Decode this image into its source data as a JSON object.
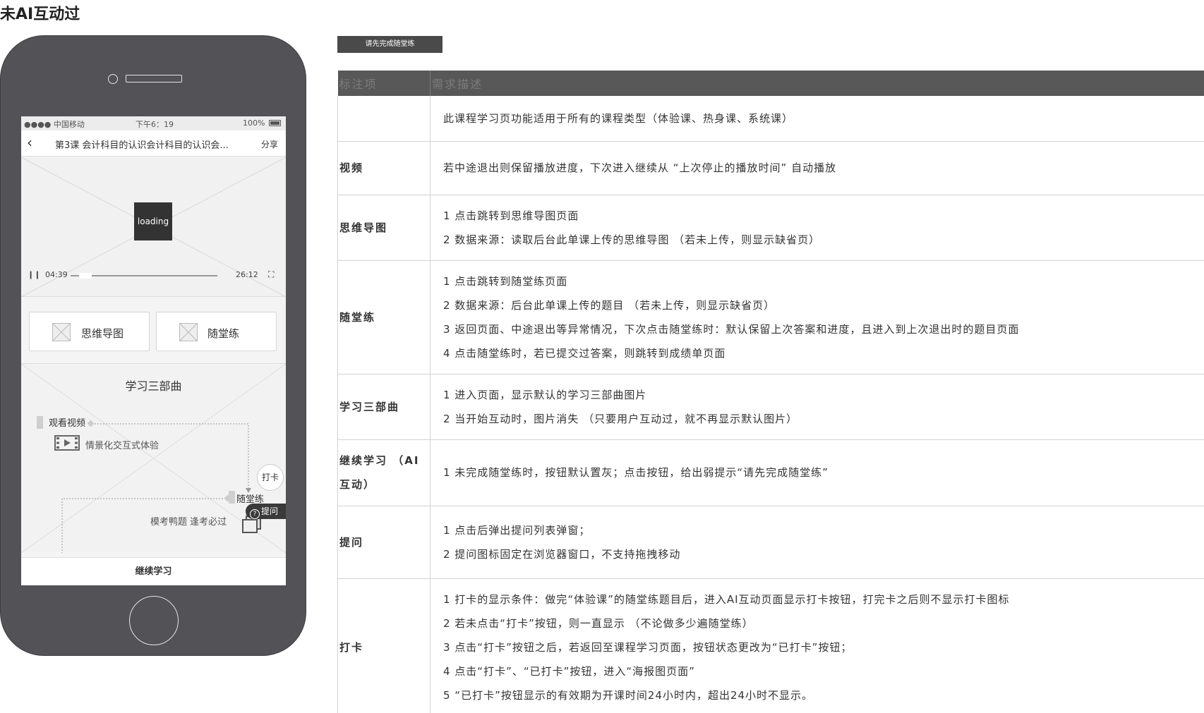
{
  "page": {
    "title": "未AI互动过"
  },
  "phone": {
    "status": {
      "carrier": "●●●● 中国移动",
      "time": "下午6：19",
      "battery": "100%"
    },
    "nav": {
      "back": "‹",
      "title": "第3课 会计科目的认识会计科目的认识会...",
      "share": "分享"
    },
    "video": {
      "loading": "loading",
      "current_time": "04:39",
      "total_time": "26:12",
      "progress": 0.1
    },
    "tiles": [
      {
        "label": "思维导图"
      },
      {
        "label": "随堂练"
      }
    ],
    "steps": {
      "title": "学习三部曲",
      "step1": "观看视频",
      "step1_sub": "情景化交互式体验",
      "step2": "随堂练",
      "step2_sub": "模考鸭题 逢考必过",
      "checkin": "打卡",
      "ask": "提问",
      "ask_icon": "?"
    },
    "continue": "继续学习"
  },
  "toast": {
    "text": "请先完成随堂练"
  },
  "table": {
    "headers": [
      "标注项",
      "需求描述"
    ],
    "rows": [
      {
        "label": "",
        "lines": [
          "此课程学习页功能适用于所有的课程类型（体验课、热身课、系统课）"
        ]
      },
      {
        "label": "视频",
        "lines": [
          "若中途退出则保留播放进度，下次进入继续从 “上次停止的播放时间” 自动播放"
        ]
      },
      {
        "label": "思维导图",
        "lines": [
          "1 点击跳转到思维导图页面",
          "2 数据来源：读取后台此单课上传的思维导图 （若未上传，则显示缺省页）"
        ]
      },
      {
        "label": "随堂练",
        "lines": [
          "1 点击跳转到随堂练页面",
          "2 数据来源：后台此单课上传的题目 （若未上传，则显示缺省页）",
          "3 返回页面、中途退出等异常情况，下次点击随堂练时：默认保留上次答案和进度，且进入到上次退出时的题目页面",
          "4 点击随堂练时，若已提交过答案，则跳转到成绩单页面"
        ]
      },
      {
        "label": "学习三部曲",
        "lines": [
          "1 进入页面，显示默认的学习三部曲图片",
          "2 当开始互动时，图片消失 （只要用户互动过，就不再显示默认图片）"
        ]
      },
      {
        "label": "继续学习 （AI互动）",
        "lines": [
          "1 未完成随堂练时，按钮默认置灰；点击按钮，给出弱提示“请先完成随堂练”"
        ]
      },
      {
        "label": "提问",
        "lines": [
          "1 点击后弹出提问列表弹窗；",
          "2 提问图标固定在浏览器窗口，不支持拖拽移动"
        ]
      },
      {
        "label": "打卡",
        "lines": [
          "1 打卡的显示条件：做完“体验课”的随堂练题目后，进入AI互动页面显示打卡按钮，打完卡之后则不显示打卡图标",
          "2 若未点击“打卡”按钮，则一直显示 （不论做多少遍随堂练）",
          "3 点击“打卡”按钮之后，若返回至课程学习页面，按钮状态更改为“已打卡”按钮；",
          "4 点击“打卡”、“已打卡”按钮，进入“海报图页面”",
          "5 “已打卡”按钮显示的有效期为开课时间24小时内，超出24小时不显示。"
        ]
      }
    ]
  }
}
